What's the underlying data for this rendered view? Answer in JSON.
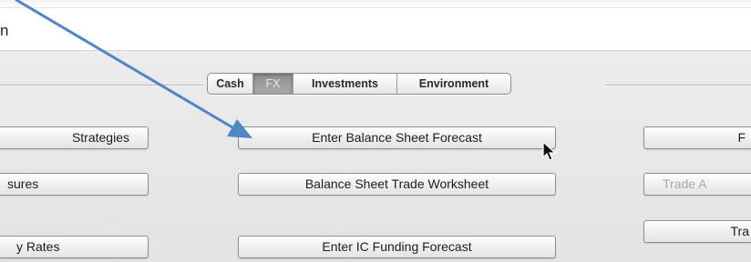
{
  "cut_text": "n",
  "tabs": [
    {
      "label": "Cash",
      "selected": false
    },
    {
      "label": "FX",
      "selected": true
    },
    {
      "label": "Investments",
      "selected": false
    },
    {
      "label": "Environment",
      "selected": false
    }
  ],
  "left_buttons": [
    "Strategies",
    "sures",
    "y Rates"
  ],
  "center_buttons": [
    "Enter Balance Sheet Forecast",
    "Balance Sheet Trade Worksheet",
    "Enter IC Funding Forecast"
  ],
  "right_buttons": [
    {
      "label": "F",
      "disabled": false
    },
    {
      "label": "Trade A",
      "disabled": true
    },
    {
      "label": "Tra",
      "disabled": false
    }
  ],
  "colors": {
    "arrow": "#4f86c6",
    "panel": "#e6e6e6"
  },
  "icons": [
    "arrow-annotation-icon",
    "mouse-cursor-icon"
  ]
}
